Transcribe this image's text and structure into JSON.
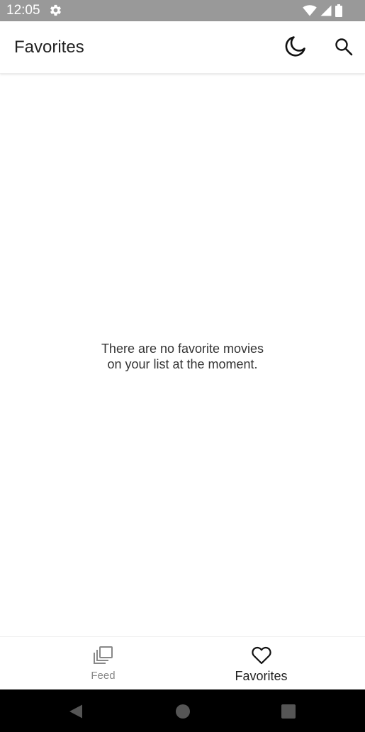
{
  "status_bar": {
    "time": "12:05",
    "background": "#999999",
    "icons": [
      "gear-icon",
      "wifi-icon",
      "signal-icon",
      "battery-icon"
    ]
  },
  "app_bar": {
    "title": "Favorites",
    "actions": [
      "moon-icon",
      "search-icon"
    ]
  },
  "empty_state": {
    "line1": "There are no favorite movies",
    "line2": "on your list at the moment."
  },
  "bottom_nav": {
    "items": [
      {
        "label": "Feed",
        "icon": "library-icon",
        "selected": false
      },
      {
        "label": "Favorites",
        "icon": "heart-outline-icon",
        "selected": true
      }
    ],
    "active_color": "#222222",
    "inactive_color": "#888888"
  },
  "system_nav": {
    "buttons": [
      "back-icon",
      "home-icon",
      "recents-icon"
    ],
    "background": "#000000",
    "button_color": "#555555"
  }
}
